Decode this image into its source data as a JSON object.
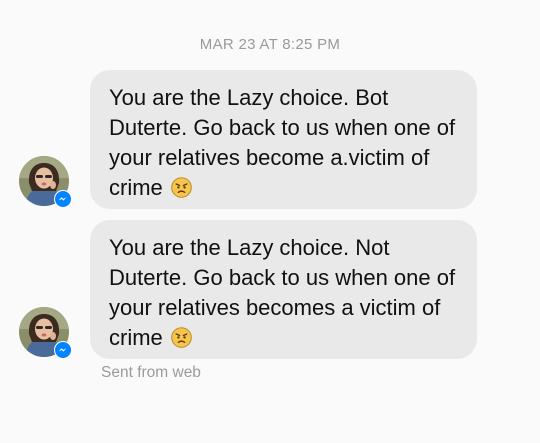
{
  "conversation": {
    "timestamp": "MAR 23 AT 8:25 PM",
    "messages": [
      {
        "text": "You are the Lazy choice. Bot Duterte. Go back to us when one of your relatives become a.victim of crime",
        "emoji": "angry-face-icon"
      },
      {
        "text": "You are the Lazy choice. Not Duterte. Go back to us when one of your relatives becomes a victim of crime",
        "emoji": "angry-face-icon"
      }
    ],
    "footer": "Sent from web"
  },
  "colors": {
    "background": "#fafafa",
    "bubble": "#e9e9e9",
    "meta_text": "#9b9b9b",
    "messenger_blue": "#0084ff"
  }
}
